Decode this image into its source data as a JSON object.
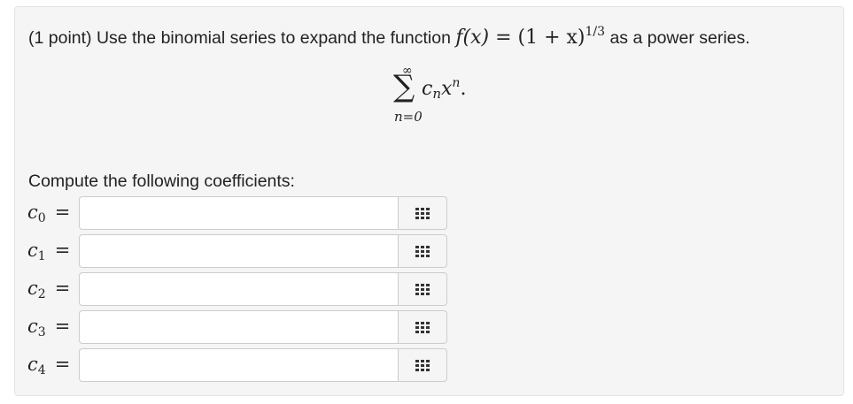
{
  "problem": {
    "prefix": "(1 point) Use the binomial series to expand the function ",
    "function_lhs": "f(x)",
    "function_rhs_base": "(1 + x)",
    "function_exponent": "1/3",
    "suffix": " as a power series.",
    "sum_upper": "∞",
    "sum_symbol": "∑",
    "sum_term": "c",
    "sum_term_sub": "n",
    "sum_term_var": "x",
    "sum_term_exp": "n",
    "sum_term_end": ".",
    "sum_lower": "n=0"
  },
  "instruction": "Compute the following coefficients:",
  "coefficients": [
    {
      "symbol": "c",
      "sub": "0",
      "eq": "=",
      "value": ""
    },
    {
      "symbol": "c",
      "sub": "1",
      "eq": "=",
      "value": ""
    },
    {
      "symbol": "c",
      "sub": "2",
      "eq": "=",
      "value": ""
    },
    {
      "symbol": "c",
      "sub": "3",
      "eq": "=",
      "value": ""
    },
    {
      "symbol": "c",
      "sub": "4",
      "eq": "=",
      "value": ""
    }
  ],
  "palette_icon": "grid-icon",
  "colors": {
    "panel_bg": "#f5f5f5",
    "panel_border": "#e3e3e3",
    "input_border": "#cccccc",
    "icon": "#333333"
  }
}
